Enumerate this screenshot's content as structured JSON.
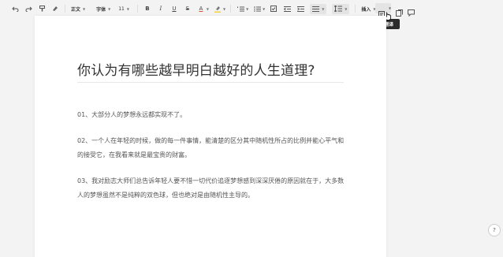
{
  "toolbar": {
    "paragraph_style": "正文",
    "font_family": "字体",
    "font_size": "11",
    "bold": "B",
    "italic": "I",
    "underline": "U",
    "strike": "S",
    "font_color": "A",
    "insert_label": "插入",
    "tooltip": "文档翻译",
    "icons": [
      "undo-icon",
      "redo-icon",
      "format-painter-icon",
      "clear-format-icon",
      "ordered-list-icon",
      "unordered-list-icon",
      "checklist-icon",
      "indent-decrease-icon",
      "indent-increase-icon",
      "align-icon",
      "line-spacing-icon",
      "translate-icon",
      "history-icon",
      "comment-icon"
    ]
  },
  "document": {
    "title": "你认为有哪些越早明白越好的人生道理?",
    "paragraphs": [
      "01、大部分人的梦想永远都实现不了。",
      "02、一个人在年轻的时候，做的每一件事情，能清楚的区分其中随机性所占的比例并能心平气和的接受它，在我看来就是最宝贵的财富。",
      "03、我对励志大师们总告诉年轻人要不惜一切代价追逐梦想感到深深厌倦的原因就在于，大多数人的梦想虽然不是纯粹的双色球，但也绝对是由随机性主导的。"
    ]
  },
  "help": {
    "label": "?"
  },
  "colors": {
    "accent": "#2b2b2b",
    "highlight": "#f5d33b",
    "font_color_bar": "#e24a2b"
  }
}
